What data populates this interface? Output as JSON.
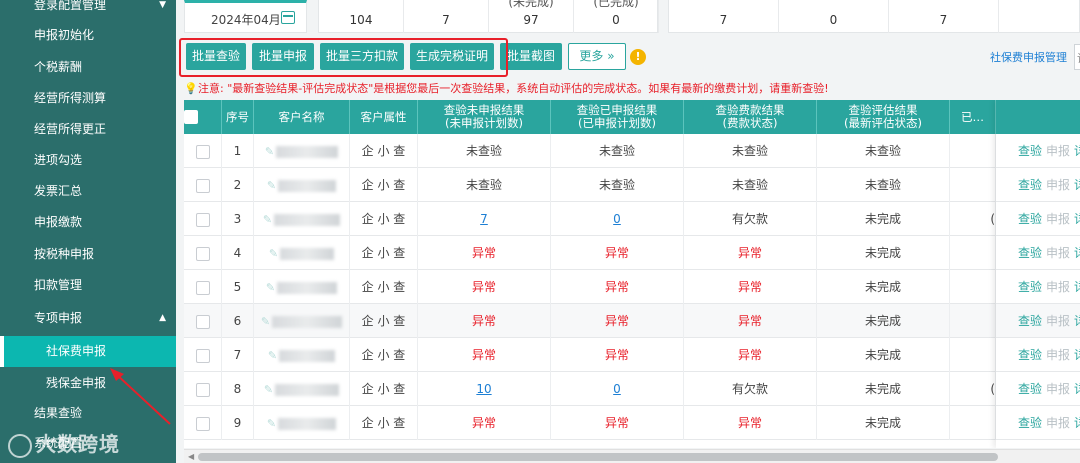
{
  "sidebar": {
    "items": [
      {
        "label": "登录配置管理",
        "arrow": "▼"
      },
      {
        "label": "申报初始化"
      },
      {
        "label": "个税薪酬"
      },
      {
        "label": "经营所得测算"
      },
      {
        "label": "经营所得更正"
      },
      {
        "label": "进项勾选"
      },
      {
        "label": "发票汇总"
      },
      {
        "label": "申报缴款"
      },
      {
        "label": "按税种申报"
      },
      {
        "label": "扣款管理"
      },
      {
        "label": "专项申报",
        "arrow": "▲"
      },
      {
        "label": "社保费申报",
        "sub": true,
        "active": true
      },
      {
        "label": "残保金申报",
        "sub": true
      },
      {
        "label": "结果查验"
      },
      {
        "label": "系统配置"
      }
    ]
  },
  "watermark": {
    "text": "大数跨境"
  },
  "summary": {
    "month": "2024年04月",
    "group1": [
      {
        "label": "",
        "value": "104"
      },
      {
        "label": "",
        "value": "7"
      },
      {
        "label": "(未完成)",
        "value": "97"
      },
      {
        "label": "(已完成)",
        "value": "0"
      }
    ],
    "group2": [
      {
        "label": "",
        "value": "7"
      },
      {
        "label": "",
        "value": "0"
      },
      {
        "label": "",
        "value": "7"
      }
    ]
  },
  "toolbar": {
    "buttons": [
      "批量查验",
      "批量申报",
      "批量三方扣款",
      "生成完税证明",
      "批量截图"
    ],
    "more": "更多 »",
    "info": "!",
    "right_link": "社保费申报管理",
    "right_select": "请"
  },
  "notice": {
    "text": "注意: \"最新查验结果-评估完成状态\"是根据您最后一次查验结果，系统自动评估的完成状态。如果有最新的缴费计划，请重新查验!"
  },
  "table": {
    "headers": [
      {
        "key": "check",
        "label": ""
      },
      {
        "key": "no",
        "label": "序号"
      },
      {
        "key": "name",
        "label": "客户名称"
      },
      {
        "key": "attr",
        "label": "客户属性"
      },
      {
        "key": "unreported",
        "label": "查验未申报结果",
        "sub": "(未申报计划数)"
      },
      {
        "key": "reported",
        "label": "查验已申报结果",
        "sub": "(已申报计划数)"
      },
      {
        "key": "fee",
        "label": "查验费款结果",
        "sub": "(费款状态)"
      },
      {
        "key": "eval",
        "label": "查验评估结果",
        "sub": "(最新评估状态)"
      },
      {
        "key": "extra",
        "label": "已…"
      }
    ],
    "rows": [
      {
        "no": "1",
        "attr": "企 小 查",
        "unreported": "未查验",
        "reported": "未查验",
        "fee": "未查验",
        "eval": "未查验",
        "extra": "",
        "style": "plain"
      },
      {
        "no": "2",
        "attr": "企 小 查",
        "unreported": "未查验",
        "reported": "未查验",
        "fee": "未查验",
        "eval": "未查验",
        "extra": "",
        "style": "plain"
      },
      {
        "no": "3",
        "attr": "企 小 查",
        "unreported": "7",
        "reported": "0",
        "fee": "有欠款",
        "eval": "未完成",
        "extra": "(",
        "style": "link"
      },
      {
        "no": "4",
        "attr": "企 小 查",
        "unreported": "异常",
        "reported": "异常",
        "fee": "异常",
        "eval": "未完成",
        "extra": "",
        "style": "error"
      },
      {
        "no": "5",
        "attr": "企 小 查",
        "unreported": "异常",
        "reported": "异常",
        "fee": "异常",
        "eval": "未完成",
        "extra": "",
        "style": "error"
      },
      {
        "no": "6",
        "attr": "企 小 查",
        "unreported": "异常",
        "reported": "异常",
        "fee": "异常",
        "eval": "未完成",
        "extra": "",
        "style": "error"
      },
      {
        "no": "7",
        "attr": "企 小 查",
        "unreported": "异常",
        "reported": "异常",
        "fee": "异常",
        "eval": "未完成",
        "extra": "",
        "style": "error"
      },
      {
        "no": "8",
        "attr": "企 小 查",
        "unreported": "10",
        "reported": "0",
        "fee": "有欠款",
        "eval": "未完成",
        "extra": "(",
        "style": "link"
      },
      {
        "no": "9",
        "attr": "企 小 查",
        "unreported": "异常",
        "reported": "异常",
        "fee": "异常",
        "eval": "未完成",
        "extra": "",
        "style": "error"
      }
    ],
    "actions": [
      "查验",
      "申报",
      "详"
    ]
  },
  "colors": {
    "sidebar_bg": "#2b6e6b",
    "sidebar_active": "#0cb7b0",
    "accent": "#2aa59e",
    "error": "#e8202a",
    "link": "#1d7fd4",
    "highlight_frame": "#e8202a"
  }
}
